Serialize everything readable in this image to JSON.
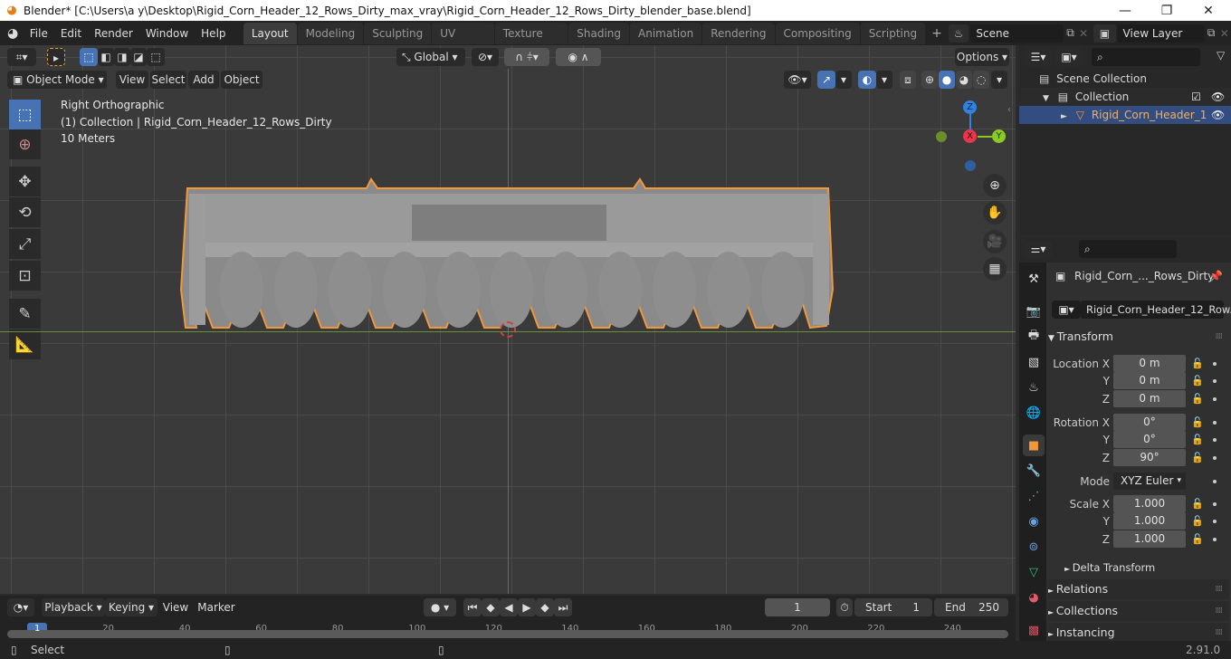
{
  "window": {
    "title": "Blender* [C:\\Users\\a y\\Desktop\\Rigid_Corn_Header_12_Rows_Dirty_max_vray\\Rigid_Corn_Header_12_Rows_Dirty_blender_base.blend]",
    "minimize": "—",
    "maximize": "❐",
    "close": "✕"
  },
  "menubar": {
    "items": [
      "File",
      "Edit",
      "Render",
      "Window",
      "Help"
    ]
  },
  "workspaces": {
    "tabs": [
      "Layout",
      "Modeling",
      "Sculpting",
      "UV Editing",
      "Texture Paint",
      "Shading",
      "Animation",
      "Rendering",
      "Compositing",
      "Scripting"
    ],
    "active": "Layout",
    "add": "+"
  },
  "scene": {
    "name": "Scene"
  },
  "view_layer": {
    "name": "View Layer"
  },
  "viewport": {
    "orientation": "Global",
    "options_label": "Options",
    "mode": "Object Mode",
    "menus": [
      "View",
      "Select",
      "Add",
      "Object"
    ],
    "overlay": {
      "view_name": "Right Orthographic",
      "collection_line": "(1) Collection | Rigid_Corn_Header_12_Rows_Dirty",
      "scale": "10 Meters"
    },
    "gizmo": {
      "z": "Z",
      "x": "X",
      "y": "Y"
    },
    "colors": {
      "selection_outline": "#f0983a",
      "x_axis": "#e8364f",
      "y_axis": "#8ac926",
      "z_axis": "#2f84e3",
      "horizon_line": "#6a8f3a",
      "vertical_line": "#4a6fa8"
    }
  },
  "outliner": {
    "search_placeholder": "",
    "items": [
      {
        "label": "Scene Collection"
      },
      {
        "label": "Collection"
      },
      {
        "label": "Rigid_Corn_Header_1"
      }
    ]
  },
  "properties": {
    "object_name": "Rigid_Corn_..._Rows_Dirty",
    "datablock": "Rigid_Corn_Header_12_Row...",
    "transform": {
      "title": "Transform",
      "location": {
        "label": "Location X",
        "x": "0 m",
        "y": "0 m",
        "z": "0 m"
      },
      "rotation": {
        "label": "Rotation X",
        "x": "0°",
        "y": "0°",
        "z": "90°"
      },
      "mode": {
        "label": "Mode",
        "value": "XYZ Euler"
      },
      "scale": {
        "label": "Scale X",
        "x": "1.000",
        "y": "1.000",
        "z": "1.000"
      },
      "axis_y": "Y",
      "axis_z": "Z",
      "delta": "Delta Transform"
    },
    "sections": [
      "Relations",
      "Collections",
      "Instancing"
    ]
  },
  "timeline": {
    "menus": [
      "Playback",
      "Keying",
      "View",
      "Marker"
    ],
    "current_frame": "1",
    "start_label": "Start",
    "start": "1",
    "end_label": "End",
    "end": "250",
    "ticks": [
      "1",
      "20",
      "40",
      "60",
      "80",
      "100",
      "120",
      "140",
      "160",
      "180",
      "200",
      "220",
      "240"
    ]
  },
  "statusbar": {
    "select": "Select",
    "version": "2.91.0"
  }
}
